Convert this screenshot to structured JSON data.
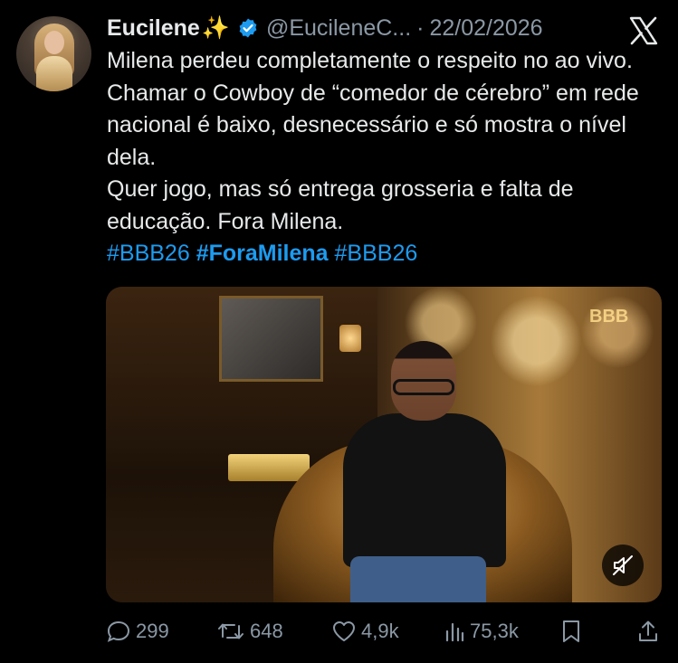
{
  "author": {
    "name": "Eucilene",
    "name_emoji": "✨",
    "handle": "@EucileneC...",
    "separator": "·",
    "date": "22/02/2026",
    "verified": true
  },
  "icons": {
    "verified": "verified-badge-icon",
    "platform": "x-logo-icon",
    "mute": "speaker-muted-icon",
    "reply": "reply-icon",
    "repost": "repost-icon",
    "like": "heart-icon",
    "views": "views-chart-icon",
    "bookmark": "bookmark-icon",
    "share": "share-icon"
  },
  "tweet": {
    "paragraph_1": "Milena perdeu completamente o respeito no ao vivo. Chamar o Cowboy de “comedor de cérebro” em rede nacional é baixo, desnecessário e só mostra o nível dela.",
    "paragraph_2": "Quer jogo, mas só entrega grosseria e falta de educação. Fora Milena.",
    "hashtags": [
      "#BBB26",
      "#ForaMilena",
      "#BBB26"
    ]
  },
  "media": {
    "watermark": "BBB"
  },
  "stats": {
    "replies": "299",
    "reposts": "648",
    "likes": "4,9k",
    "views": "75,3k"
  },
  "colors": {
    "background": "#000000",
    "text": "#e7e9ea",
    "secondary": "#8b98a5",
    "accent": "#1d9bf0"
  }
}
